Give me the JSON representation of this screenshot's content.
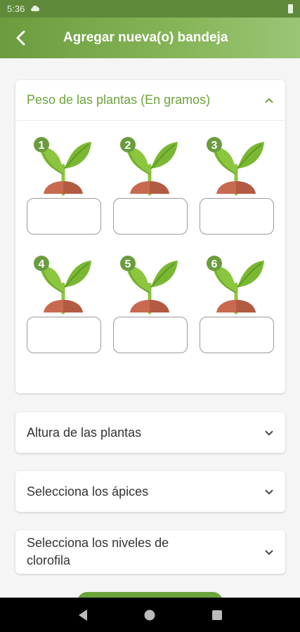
{
  "status_bar": {
    "time": "5:36"
  },
  "app_bar": {
    "title": "Agregar nueva(o) bandeja"
  },
  "colors": {
    "accent_green": "#6aa43a",
    "header_green": "#6a9c3e"
  },
  "sections": {
    "weight": {
      "title": "Peso de las plantas (En gramos)",
      "expanded": true
    },
    "height": {
      "title": "Altura de las plantas",
      "expanded": false
    },
    "apices": {
      "title": "Selecciona los ápices",
      "expanded": false
    },
    "chlorophyll": {
      "title_line1": "Selecciona los niveles de",
      "title_line2": "clorofila",
      "expanded": false
    }
  },
  "plants": [
    {
      "number": "1",
      "value": ""
    },
    {
      "number": "2",
      "value": ""
    },
    {
      "number": "3",
      "value": ""
    },
    {
      "number": "4",
      "value": ""
    },
    {
      "number": "5",
      "value": ""
    },
    {
      "number": "6",
      "value": ""
    }
  ],
  "icons": {
    "back": "arrow-left-icon",
    "expand": "chevron-down-icon",
    "collapse": "chevron-up-icon",
    "plant": "sprout-icon"
  }
}
